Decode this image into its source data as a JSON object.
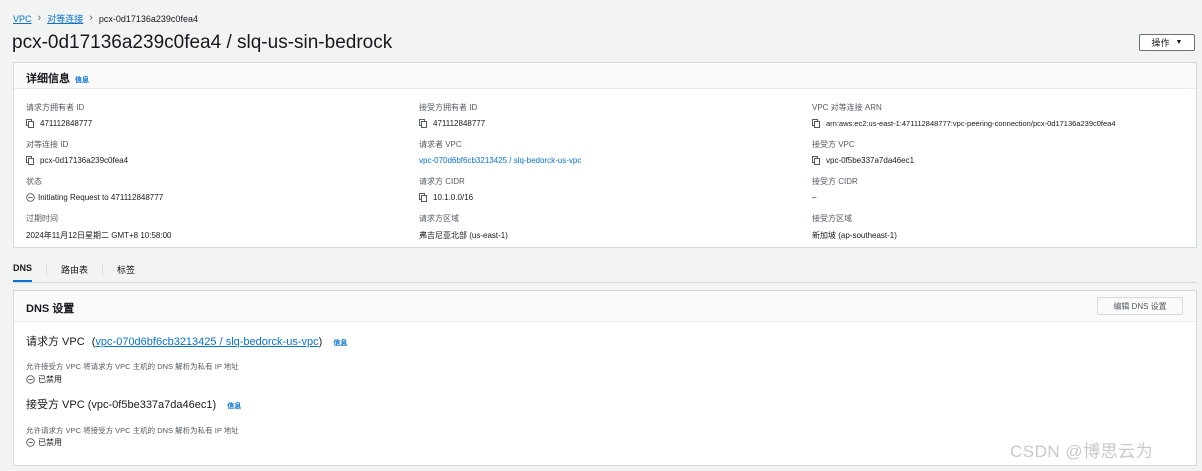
{
  "breadcrumb": {
    "items": [
      {
        "label": "VPC"
      },
      {
        "label": "对等连接"
      },
      {
        "label": "pcx-0d17136a239c0fea4"
      }
    ]
  },
  "page": {
    "title": "pcx-0d17136a239c0fea4 / slq-us-sin-bedrock",
    "actions_label": "操作"
  },
  "details": {
    "title": "详细信息",
    "info_label": "信息",
    "fields": {
      "requester_owner": {
        "label": "请求方拥有者 ID",
        "value": "471112848777"
      },
      "accepter_owner": {
        "label": "接受方拥有者 ID",
        "value": "471112848777"
      },
      "arn": {
        "label": "VPC 对等连接 ARN",
        "value": "arn:aws:ec2:us-east-1:471112848777:vpc-peering-connection/pcx-0d17136a239c0fea4"
      },
      "peering_id": {
        "label": "对等连接 ID",
        "value": "pcx-0d17136a239c0fea4"
      },
      "requester_vpc": {
        "label": "请求者 VPC",
        "value": "vpc-070d6bf6cb3213425 / slq-bedorck-us-vpc"
      },
      "accepter_vpc": {
        "label": "接受方 VPC",
        "value": "vpc-0f5be337a7da46ec1"
      },
      "status": {
        "label": "状态",
        "value": "Initiating Request to 471112848777"
      },
      "requester_cidr": {
        "label": "请求方 CIDR",
        "value": "10.1.0.0/16"
      },
      "accepter_cidr": {
        "label": "接受方 CIDR",
        "value": "–"
      },
      "expiration": {
        "label": "过期时间",
        "value": "2024年11月12日星期二 GMT+8 10:58:00"
      },
      "requester_region": {
        "label": "请求方区域",
        "value": "弗吉尼亚北部 (us-east-1)"
      },
      "accepter_region": {
        "label": "接受方区域",
        "value": "新加坡 (ap-southeast-1)"
      }
    }
  },
  "tabs": [
    {
      "label": "DNS",
      "active": true
    },
    {
      "label": "路由表",
      "active": false
    },
    {
      "label": "标签",
      "active": false
    }
  ],
  "dns": {
    "title": "DNS 设置",
    "edit_label": "编辑 DNS 设置",
    "requester": {
      "prefix": "请求方 VPC",
      "paren_open": "(",
      "link": "vpc-070d6bf6cb3213425 / slq-bedorck-us-vpc",
      "paren_close": ")",
      "info_label": "信息",
      "description": "允许接受方 VPC 将请求方 VPC 主机的 DNS 解析为私有 IP 地址",
      "status": "已禁用"
    },
    "accepter": {
      "heading": "接受方 VPC (vpc-0f5be337a7da46ec1)",
      "info_label": "信息",
      "description": "允许请求方 VPC 将接受方 VPC 主机的 DNS 解析为私有 IP 地址",
      "status": "已禁用"
    }
  },
  "watermark": "CSDN @博思云为",
  "colors": {
    "link": "#0972d3",
    "background": "#f2f3f3",
    "panel": "#ffffff",
    "border": "#d5dbdb"
  }
}
